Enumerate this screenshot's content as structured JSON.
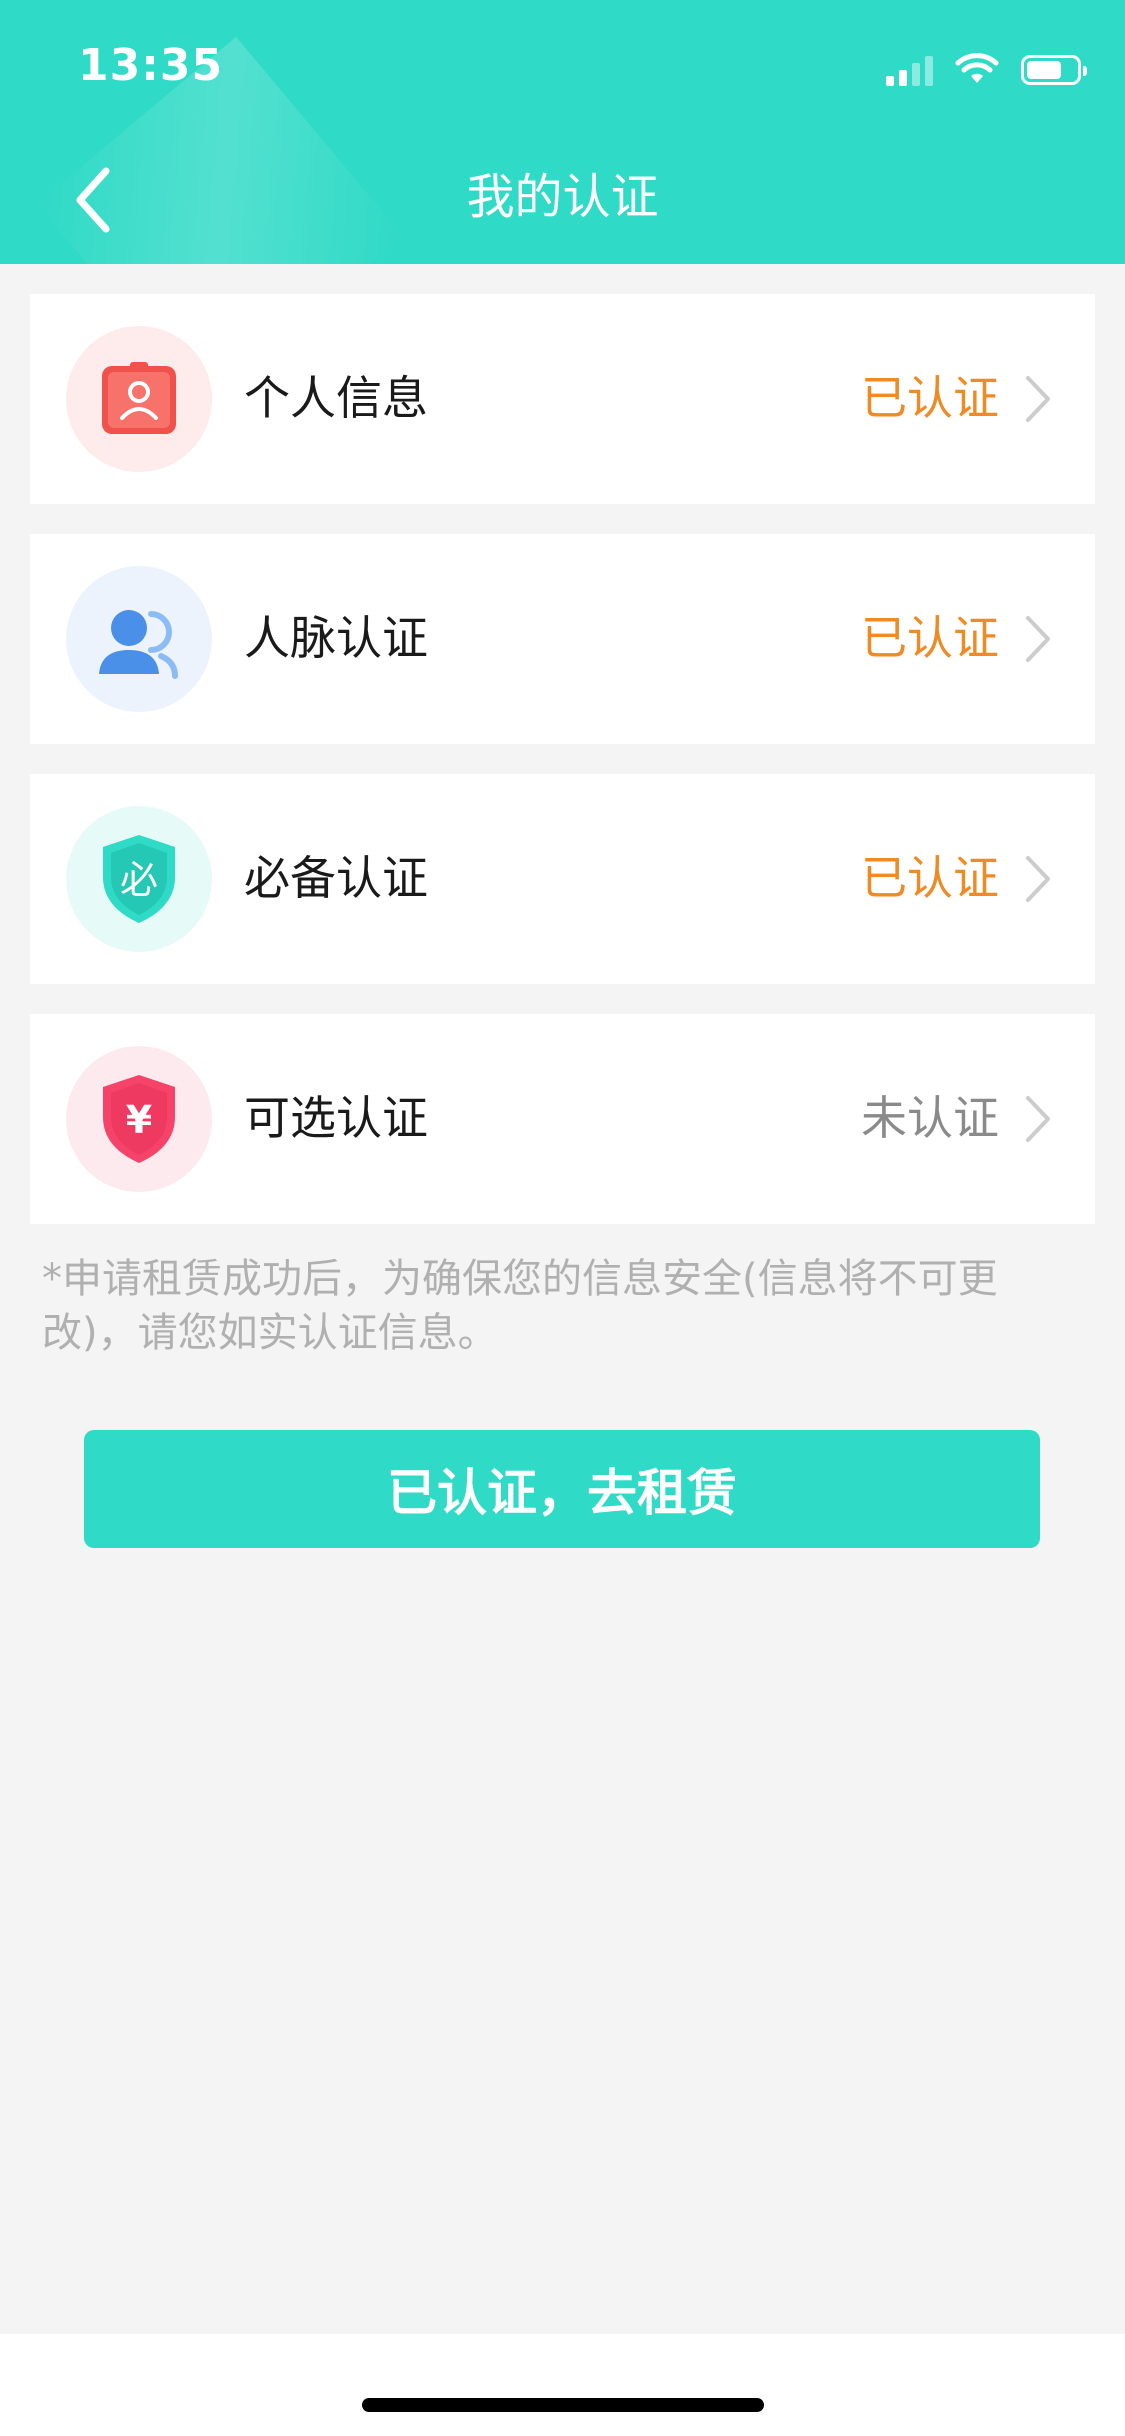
{
  "status_bar": {
    "time": "13:35"
  },
  "header": {
    "title": "我的认证",
    "back_icon": "chevron-left-icon"
  },
  "items": [
    {
      "label": "个人信息",
      "status": "已认证",
      "status_color": "#f08a24",
      "icon": "id-card-icon"
    },
    {
      "label": "人脉认证",
      "status": "已认证",
      "status_color": "#f08a24",
      "icon": "contacts-icon"
    },
    {
      "label": "必备认证",
      "status": "已认证",
      "status_color": "#f08a24",
      "icon": "required-shield-icon"
    },
    {
      "label": "可选认证",
      "status": "未认证",
      "status_color": "#8a8a8a",
      "icon": "yen-shield-icon"
    }
  ],
  "note": "*申请租赁成功后，为确保您的信息安全(信息将不可更改)，请您如实认证信息。",
  "cta_label": "已认证，去租赁",
  "colors": {
    "accent": "#2fdac6",
    "verified": "#f08a24",
    "unverified": "#8a8a8a",
    "background": "#f4f4f4"
  }
}
